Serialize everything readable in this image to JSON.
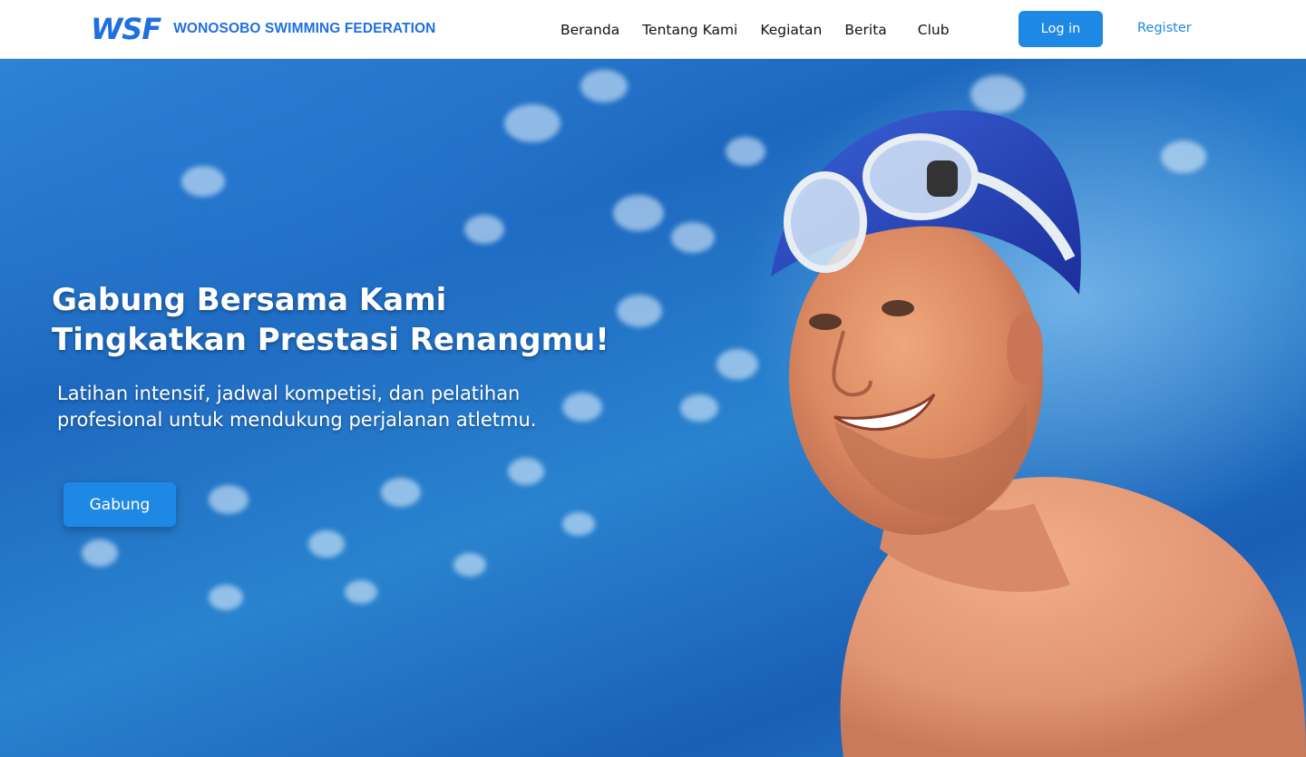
{
  "brand": {
    "mark": "WSF",
    "name": "WONOSOBO SWIMMING FEDERATION"
  },
  "nav": {
    "items": [
      "Beranda",
      "Tentang Kami",
      "Kegiatan",
      "Berita",
      "Club"
    ]
  },
  "auth": {
    "login_label": "Log in",
    "register_label": "Register"
  },
  "hero": {
    "title_line1": "Gabung Bersama Kami",
    "title_line2": "Tingkatkan Prestasi Renangmu!",
    "subtitle": "Latihan intensif, jadwal kompetisi, dan pelatihan profesional untuk mendukung perjalanan atletmu.",
    "cta_label": "Gabung"
  },
  "colors": {
    "brand_blue": "#1f6fe0",
    "button_blue": "#1e88e5",
    "header_bg": "#ffffff",
    "nav_text": "#111111"
  }
}
